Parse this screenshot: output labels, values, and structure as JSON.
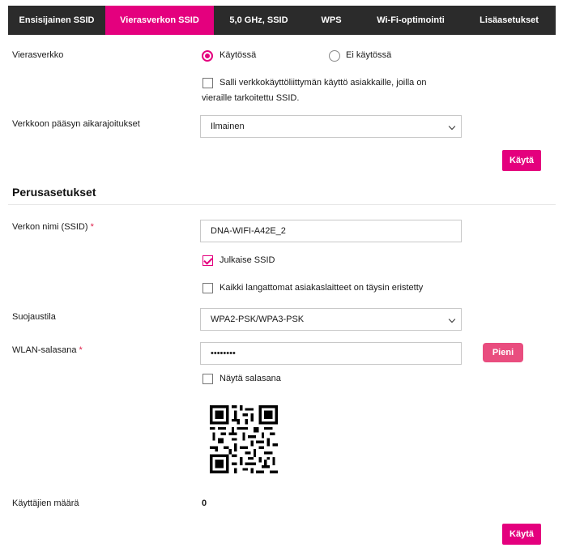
{
  "tabs": [
    {
      "label": "Ensisijainen SSID"
    },
    {
      "label": "Vierasverkon SSID"
    },
    {
      "label": "5,0 GHz, SSID"
    },
    {
      "label": "WPS"
    },
    {
      "label": "Wi-Fi-optimointi"
    },
    {
      "label": "Lisäasetukset"
    }
  ],
  "active_tab": "Vierasverkon SSID",
  "guest": {
    "label": "Vierasverkko",
    "option_on": "Käytössä",
    "option_off": "Ei käytössä",
    "selected": "Käytössä",
    "allow_ui_line1": "Salli verkkokäyttöliittymän käyttö asiakkaille, joilla on",
    "allow_ui_line2": "vieraille tarkoitettu SSID.",
    "allow_ui_checked": false
  },
  "time_limit": {
    "label": "Verkkoon pääsyn aikarajoitukset",
    "value": "Ilmainen"
  },
  "apply_label": "Käytä",
  "basic": {
    "title": "Perusasetukset",
    "ssid_label": "Verkon nimi (SSID)",
    "required_mark": "*",
    "ssid_value": "DNA-WIFI-A42E_2",
    "publish_label": "Julkaise SSID",
    "publish_checked": true,
    "isolate_label": "Kaikki langattomat asiakaslaitteet on täysin eristetty",
    "isolate_checked": false,
    "security_label": "Suojaustila",
    "security_value": "WPA2-PSK/WPA3-PSK",
    "password_label": "WLAN-salasana",
    "password_value": "••••••••",
    "password_strength": "Pieni",
    "show_password_label": "Näytä salasana",
    "show_password_checked": false,
    "users_label": "Käyttäjien määrä",
    "users_value": "0"
  },
  "colors": {
    "accent": "#e4007e",
    "tab_bar": "#2b2b2b",
    "strength_button": "#e94d7f",
    "required": "#e0204a"
  }
}
